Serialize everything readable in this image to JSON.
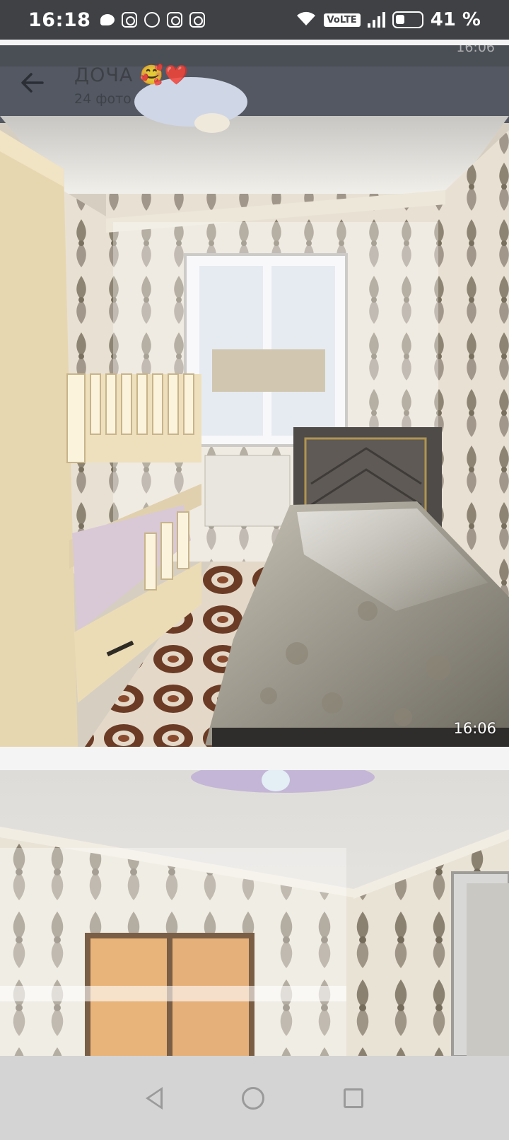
{
  "status_bar": {
    "time": "16:18",
    "left_icons": [
      "chat-bubble-icon",
      "instagram-icon",
      "whatsapp-icon",
      "instagram-icon",
      "instagram-icon"
    ],
    "volte": "VoLTE",
    "battery": "41 %"
  },
  "header": {
    "title": "ДОЧА 🥰❤️",
    "subtitle": "24 фото",
    "top_timestamp": "16:06"
  },
  "photos": [
    {
      "timestamp": "16:06",
      "subject": "bedroom-bunk-bed"
    },
    {
      "timestamp": "",
      "subject": "bedroom-window"
    }
  ],
  "colors": {
    "status_bar_bg": "#3f4144",
    "nav_bar_bg": "#d4d4d4",
    "wallpaper": "#e9e2d4",
    "damask": "#8c8272",
    "furniture": "#e8d9b6",
    "carpet": "#6b3b25"
  }
}
